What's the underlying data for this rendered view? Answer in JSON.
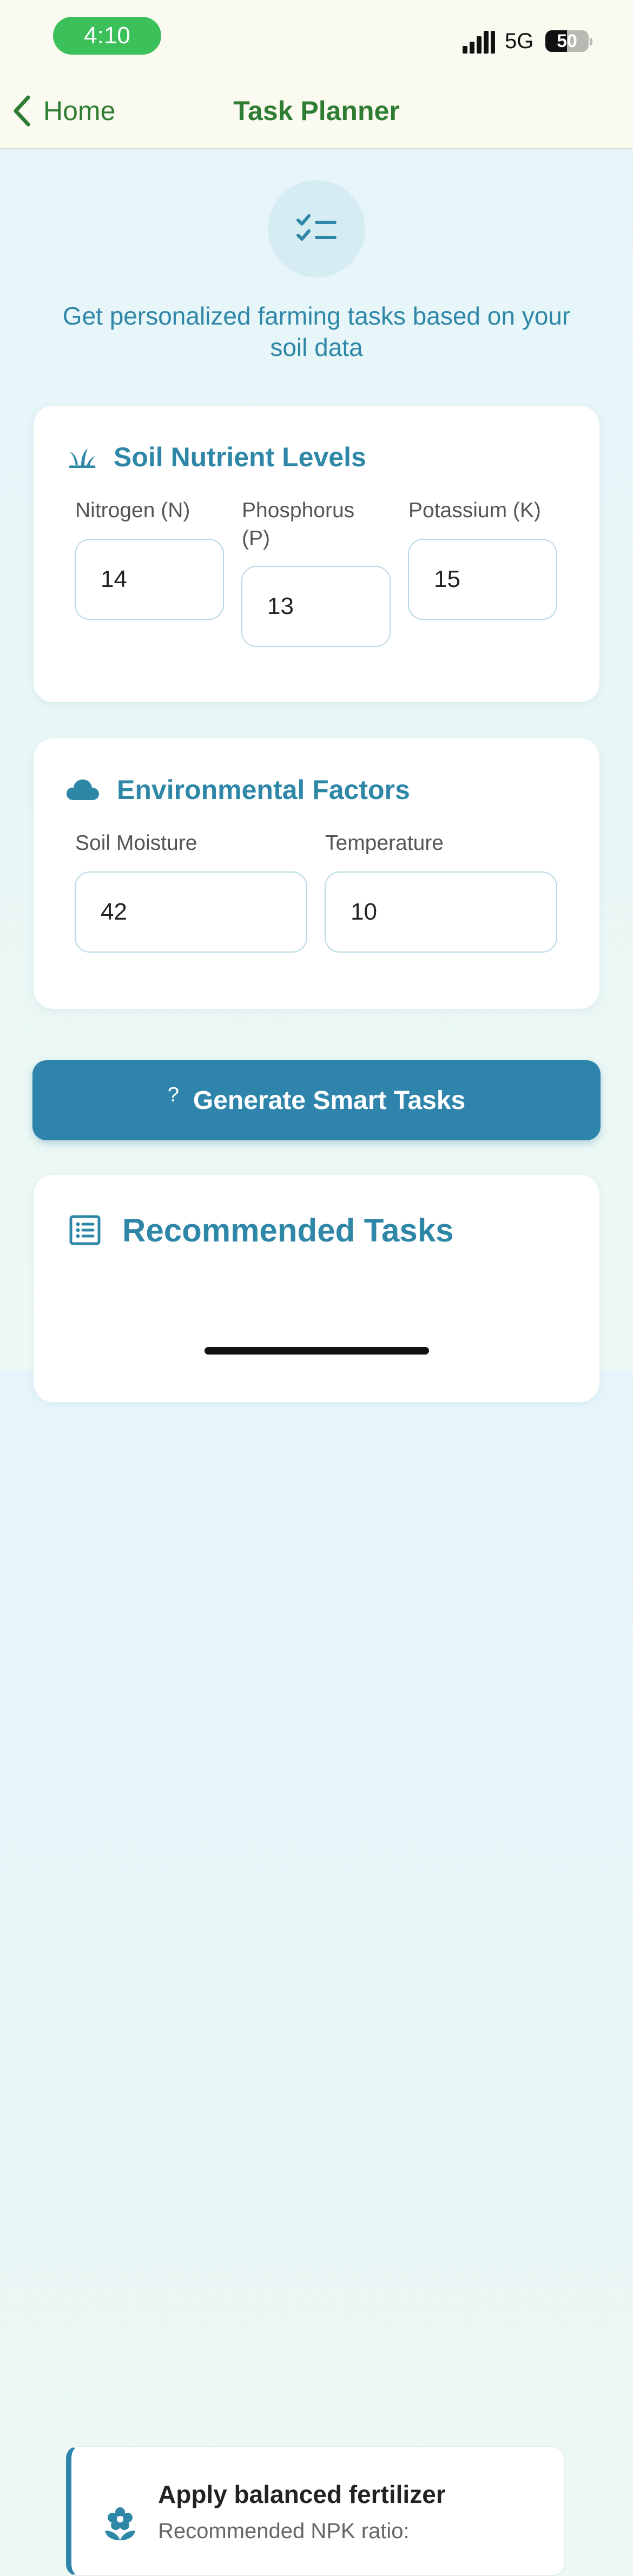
{
  "status_bar": {
    "time": "4:10",
    "network": "5G",
    "battery_level": "50",
    "battery_fraction": 0.5
  },
  "nav": {
    "back_label": "Home",
    "title": "Task Planner"
  },
  "hero": {
    "icon": "checklist-icon",
    "subtitle": "Get personalized farming tasks based on your soil data"
  },
  "soil_card": {
    "title": "Soil Nutrient Levels",
    "icon": "sprout-icon",
    "fields": [
      {
        "label": "Nitrogen (N)",
        "value": "14"
      },
      {
        "label": "Phosphorus (P)",
        "value": "13"
      },
      {
        "label": "Potassium (K)",
        "value": "15"
      }
    ]
  },
  "env_card": {
    "title": "Environmental Factors",
    "icon": "cloud-icon",
    "fields": [
      {
        "label": "Soil Moisture",
        "value": "42"
      },
      {
        "label": "Temperature",
        "value": "10"
      }
    ]
  },
  "generate_button": {
    "icon_glyph": "?",
    "label": "Generate Smart Tasks"
  },
  "tasks_card": {
    "title": "Recommended Tasks",
    "icon": "list-icon",
    "items": [
      {
        "icon": "flower-icon",
        "title": "Apply balanced fertilizer",
        "description": "Recommended NPK ratio:"
      }
    ]
  },
  "colors": {
    "accent_green": "#2f7d33",
    "accent_blue": "#2f87a8",
    "button_blue": "#2e84ab",
    "status_green": "#3cc05a"
  }
}
